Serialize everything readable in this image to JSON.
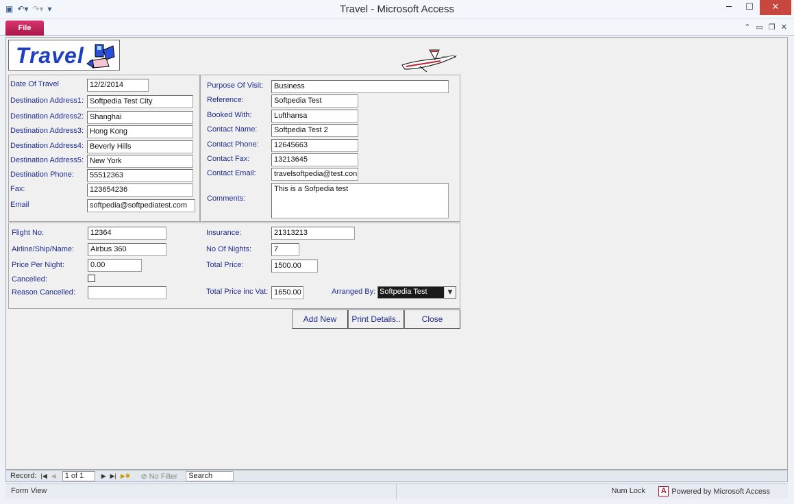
{
  "window": {
    "title": "Travel  -  Microsoft Access",
    "controls": {
      "minimize": "─",
      "maximize": "☐",
      "close": "✕"
    }
  },
  "ribbon": {
    "file_tab": "File",
    "controls": {
      "help": "⌃",
      "minimize": "▭",
      "restore": "❐",
      "close": "✕"
    }
  },
  "logo": {
    "text": "Travel"
  },
  "form": {
    "top_left": {
      "date_of_travel": {
        "label": "Date Of Travel",
        "value": "12/2/2014"
      },
      "dest1": {
        "label": "Destination Address1:",
        "value": "Softpedia Test City"
      },
      "dest2": {
        "label": "Destination Address2:",
        "value": "Shanghai"
      },
      "dest3": {
        "label": "Destination Address3:",
        "value": "Hong Kong"
      },
      "dest4": {
        "label": "Destination Address4:",
        "value": "Beverly Hills"
      },
      "dest5": {
        "label": "Destination Address5:",
        "value": "New York"
      },
      "dest_phone": {
        "label": "Destination Phone:",
        "value": "55512363"
      },
      "fax": {
        "label": "Fax:",
        "value": "123654236"
      },
      "email": {
        "label": "Email",
        "value": "softpedia@softpediatest.com"
      }
    },
    "top_right": {
      "purpose": {
        "label": "Purpose Of Visit:",
        "value": "Business"
      },
      "reference": {
        "label": "Reference:",
        "value": "Softpedia Test"
      },
      "booked_with": {
        "label": "Booked With:",
        "value": "Lufthansa"
      },
      "contact_name": {
        "label": "Contact Name:",
        "value": "Softpedia Test 2"
      },
      "contact_phone": {
        "label": "Contact Phone:",
        "value": "12645663"
      },
      "contact_fax": {
        "label": "Contact Fax:",
        "value": "13213645"
      },
      "contact_email": {
        "label": "Contact Email:",
        "value": "travelsoftpedia@test.con"
      },
      "comments": {
        "label": "Comments:",
        "value": "This is a Sofpedia test"
      }
    },
    "bottom": {
      "flight_no": {
        "label": "Flight No:",
        "value": "12364"
      },
      "airline": {
        "label": "Airline/Ship/Name:",
        "value": "Airbus 360"
      },
      "price_per_night": {
        "label": "Price Per Night:",
        "value": "0.00"
      },
      "cancelled": {
        "label": "Cancelled:",
        "checked": false
      },
      "reason_cancelled": {
        "label": "Reason Cancelled:",
        "value": ""
      },
      "insurance": {
        "label": "Insurance:",
        "value": "21313213"
      },
      "nights": {
        "label": "No Of Nights:",
        "value": "7"
      },
      "total_price": {
        "label": "Total Price:",
        "value": "1500.00"
      },
      "total_vat": {
        "label": "Total Price inc Vat:",
        "value": "1650.00"
      },
      "arranged_by": {
        "label": "Arranged By:",
        "value": "Softpedia Test"
      }
    },
    "buttons": {
      "add_new": "Add New",
      "print": "Print Details..",
      "close": "Close"
    }
  },
  "record_nav": {
    "label": "Record:",
    "current": "1 of 1",
    "no_filter": "No Filter",
    "search": "Search"
  },
  "status": {
    "view": "Form View",
    "num_lock": "Num Lock",
    "powered": "Powered by Microsoft Access"
  },
  "colors": {
    "label": "#1e2b8f",
    "file_tab": "#c0245a",
    "logo": "#1d3fc1"
  }
}
